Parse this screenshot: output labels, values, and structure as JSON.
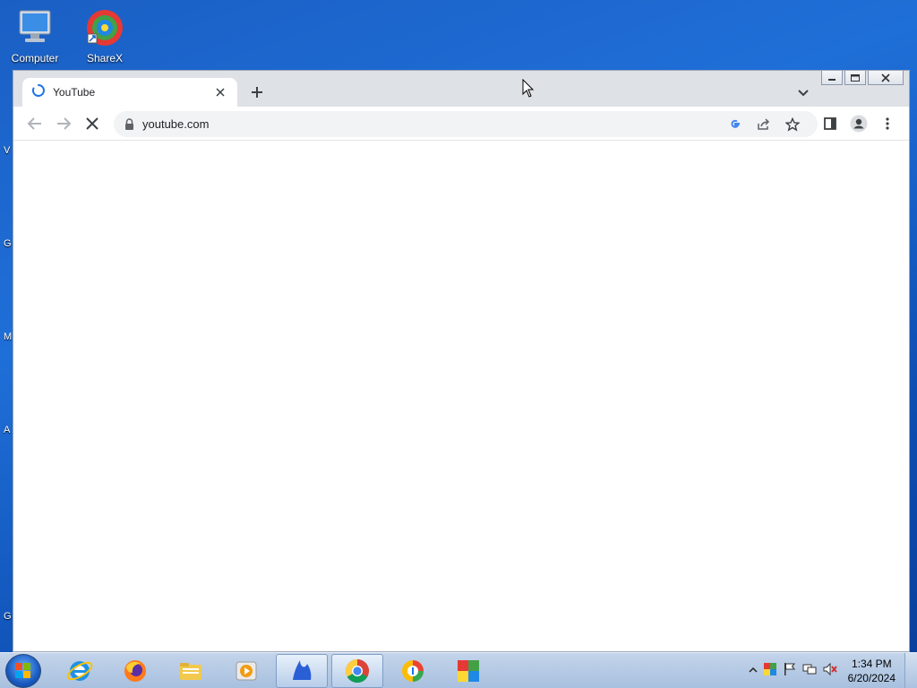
{
  "desktop": {
    "icons": [
      {
        "label": "Computer",
        "icon": "computer-icon"
      },
      {
        "label": "ShareX",
        "icon": "sharex-icon"
      }
    ],
    "edge_letters": [
      "V",
      "G",
      "M",
      "A",
      "G"
    ]
  },
  "browser": {
    "tab": {
      "title": "YouTube",
      "loading": true
    },
    "address": {
      "url": "youtube.com"
    },
    "icons": [
      "back-icon",
      "forward-icon",
      "stop-icon",
      "lock-icon",
      "google-lens-icon",
      "share-icon",
      "bookmark-star-icon",
      "side-panel-icon",
      "profile-icon",
      "menu-dots-icon",
      "new-tab-icon",
      "tab-search-icon"
    ]
  },
  "taskbar": {
    "apps": [
      "internet-explorer-icon",
      "firefox-icon",
      "file-explorer-icon",
      "media-player-icon",
      "app-blue-icon",
      "chrome-icon",
      "app-shield-icon",
      "app-grid-icon"
    ],
    "active_app": "chrome-icon",
    "clock": {
      "time": "1:34 PM",
      "date": "6/20/2024"
    }
  },
  "colors": {
    "accent": "#1a73e8",
    "taskbar": "#a8c0df",
    "desktop": "#1f6fd8"
  }
}
